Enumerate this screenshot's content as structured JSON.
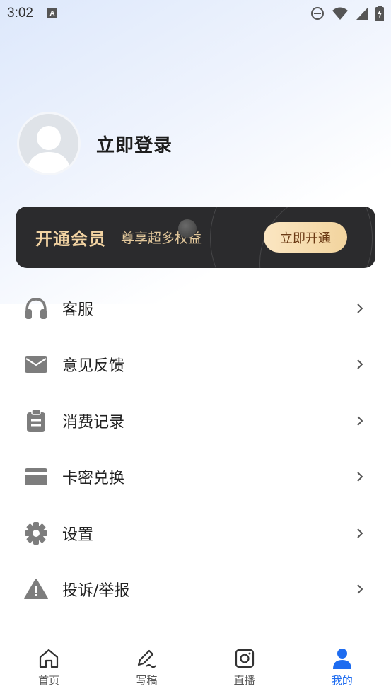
{
  "status_bar": {
    "time": "3:02",
    "badge": "A"
  },
  "profile": {
    "login_label": "立即登录"
  },
  "vip": {
    "title": "开通会员",
    "subtitle": "尊享超多权益",
    "button": "立即开通"
  },
  "menu": [
    {
      "label": "客服",
      "icon": "headset-icon"
    },
    {
      "label": "意见反馈",
      "icon": "mail-icon"
    },
    {
      "label": "消费记录",
      "icon": "clipboard-icon"
    },
    {
      "label": "卡密兑换",
      "icon": "card-icon"
    },
    {
      "label": "设置",
      "icon": "gear-icon"
    },
    {
      "label": "投诉/举报",
      "icon": "warning-icon"
    }
  ],
  "tabs": [
    {
      "label": "首页",
      "icon": "home-icon",
      "active": false
    },
    {
      "label": "写稿",
      "icon": "pen-icon",
      "active": false
    },
    {
      "label": "直播",
      "icon": "camera-icon",
      "active": false
    },
    {
      "label": "我的",
      "icon": "person-icon",
      "active": true
    }
  ],
  "colors": {
    "accent": "#1e6cf0",
    "vip_gold": "#f2d3a2",
    "vip_bg": "#2b2b2d",
    "icon_gray": "#7d7d7d"
  }
}
